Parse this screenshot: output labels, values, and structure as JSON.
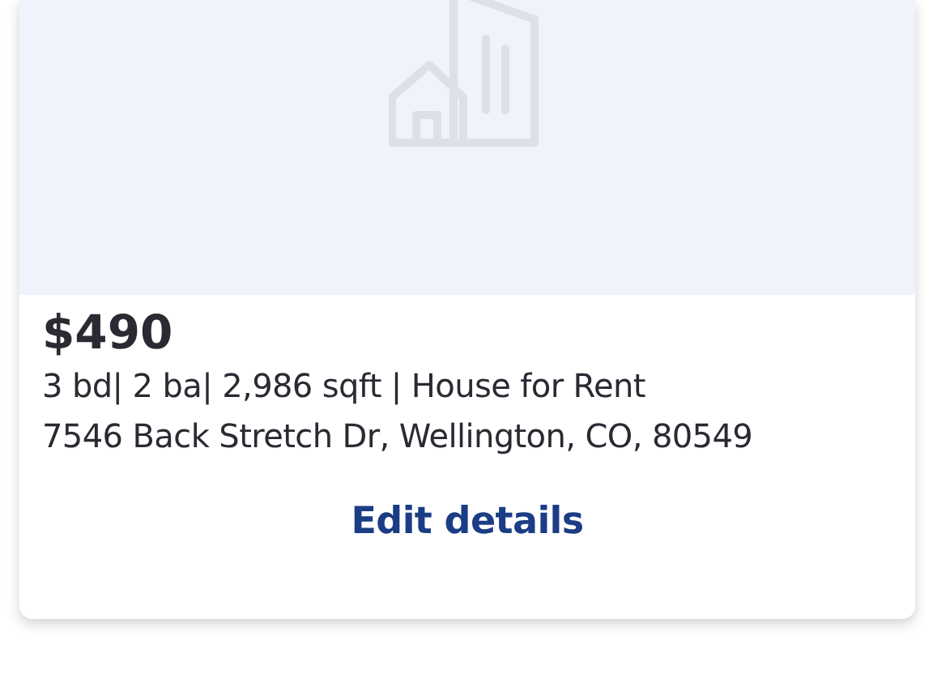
{
  "listing": {
    "price": "$490",
    "details": "3 bd| 2 ba| 2,986 sqft | House for Rent",
    "address": "7546 Back Stretch Dr, Wellington, CO, 80549",
    "action": "Edit details"
  }
}
